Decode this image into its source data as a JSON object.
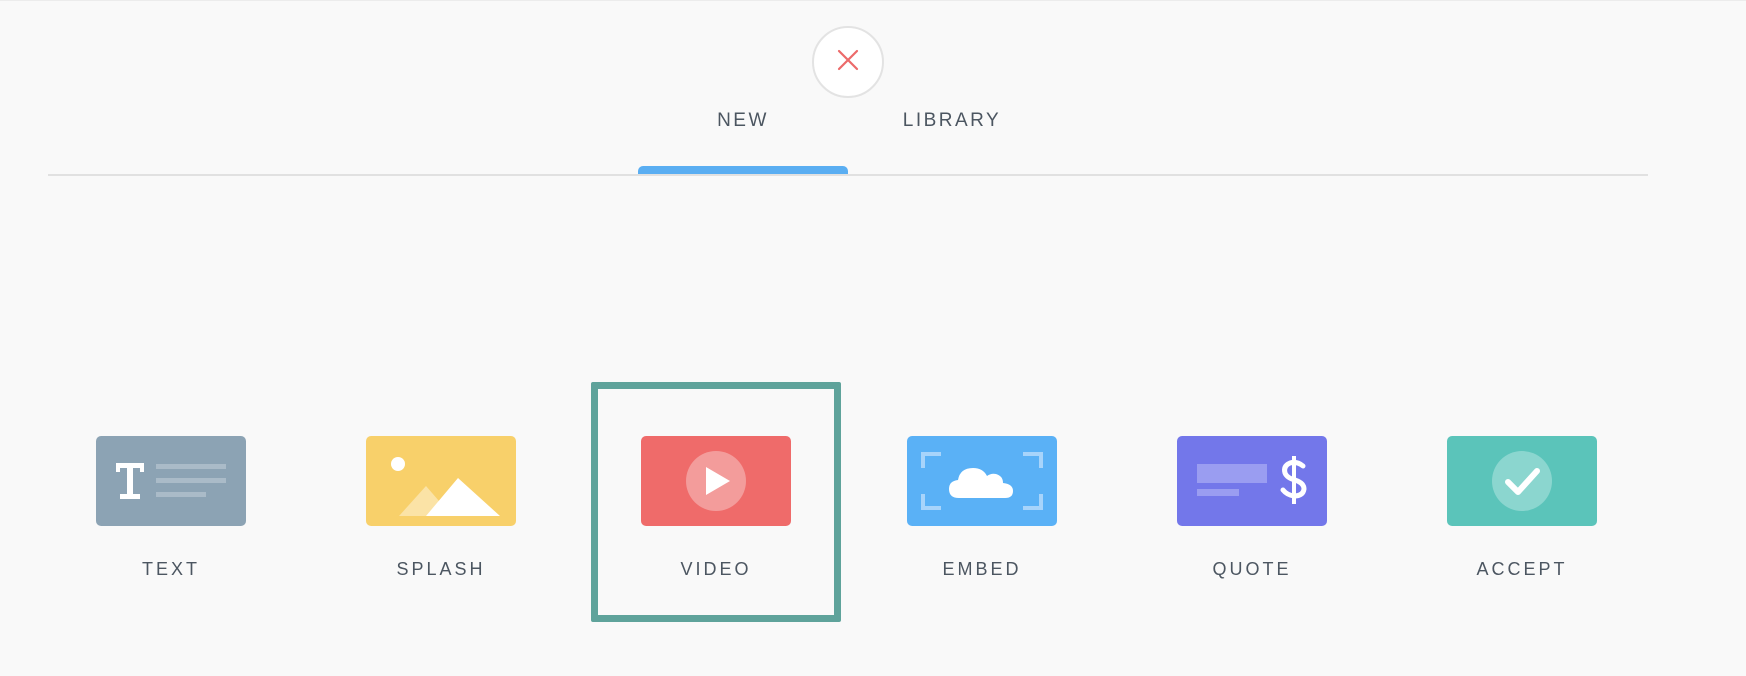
{
  "close_button": {
    "icon": "close-icon",
    "color": "#ec6a6a"
  },
  "tabs": [
    {
      "label": "NEW",
      "active": true
    },
    {
      "label": "LIBRARY",
      "active": false
    }
  ],
  "accent_color": "#5aaef2",
  "selection_color": "#5fa39b",
  "blocks": [
    {
      "label": "TEXT",
      "icon": "text-block-icon",
      "color": "#8ca3b4",
      "selected": false
    },
    {
      "label": "SPLASH",
      "icon": "image-block-icon",
      "color": "#f8d06a",
      "selected": false
    },
    {
      "label": "VIDEO",
      "icon": "play-icon",
      "color": "#ef6b6a",
      "selected": true
    },
    {
      "label": "EMBED",
      "icon": "cloud-icon",
      "color": "#5ab1f6",
      "selected": false
    },
    {
      "label": "QUOTE",
      "icon": "dollar-icon",
      "color": "#7377ea",
      "selected": false
    },
    {
      "label": "ACCEPT",
      "icon": "check-icon",
      "color": "#5bc4ba",
      "selected": false
    }
  ]
}
